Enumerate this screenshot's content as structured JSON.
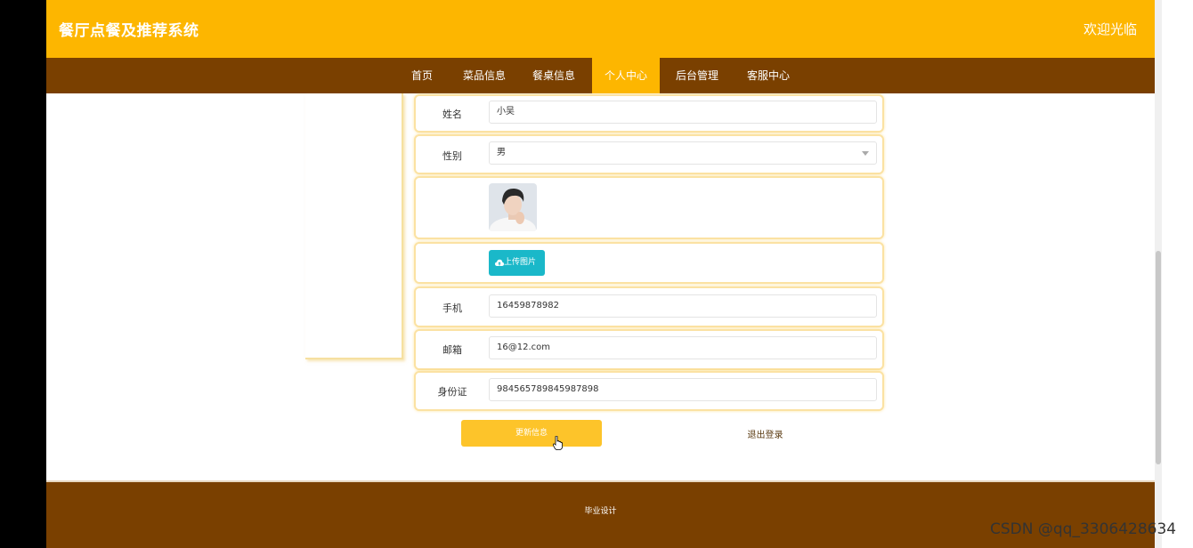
{
  "header": {
    "title": "餐厅点餐及推荐系统",
    "welcome": "欢迎光临"
  },
  "nav": {
    "items": [
      {
        "label": "首页"
      },
      {
        "label": "菜品信息"
      },
      {
        "label": "餐桌信息"
      },
      {
        "label": "个人中心",
        "active": true
      },
      {
        "label": "后台管理"
      },
      {
        "label": "客服中心"
      }
    ]
  },
  "form": {
    "name": {
      "label": "姓名",
      "value": "小吴"
    },
    "gender": {
      "label": "性别",
      "value": "男"
    },
    "avatar": {
      "icon": "user-photo"
    },
    "upload": {
      "label": "上传图片",
      "icon": "cloud-upload-icon"
    },
    "phone": {
      "label": "手机",
      "value": "16459878982"
    },
    "email": {
      "label": "邮箱",
      "value": "16@12.com"
    },
    "idcard": {
      "label": "身份证",
      "value": "984565789845987898"
    },
    "update_label": "更新信息",
    "logout_label": "退出登录"
  },
  "footer": {
    "text": "毕业设计"
  },
  "watermark": "CSDN @qq_3306428634",
  "colors": {
    "primary": "#fdb600",
    "nav": "#7a4000",
    "upload": "#1ab8c9",
    "button": "#fdc42a"
  }
}
